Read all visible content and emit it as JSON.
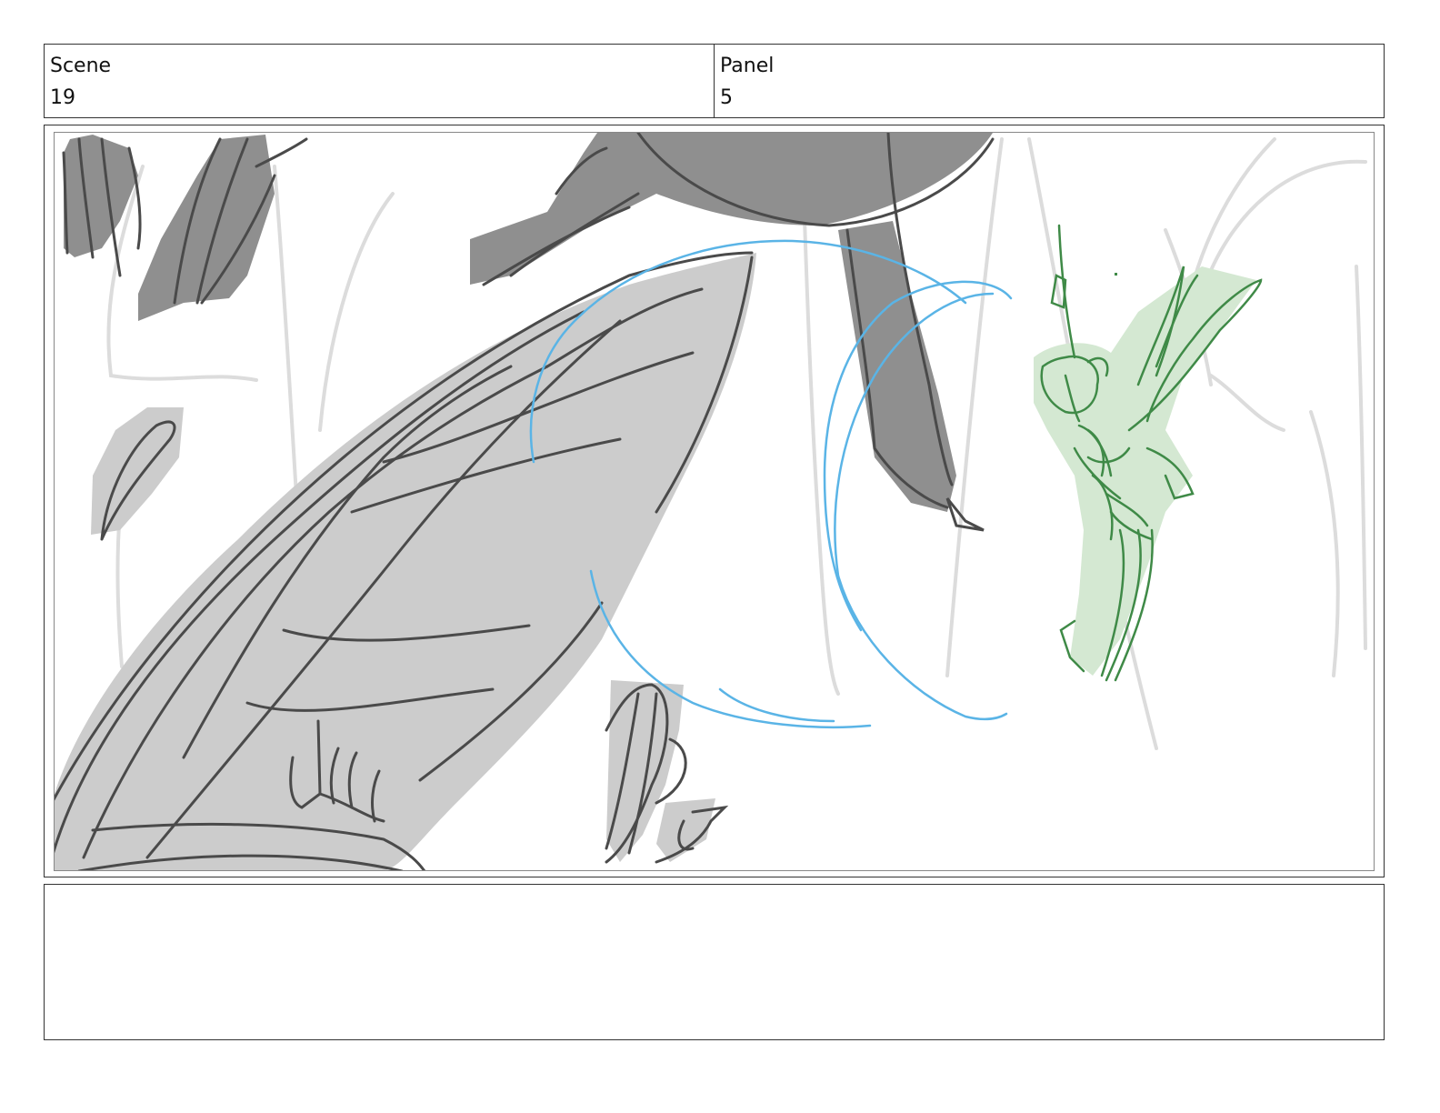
{
  "header": {
    "scene_label": "Scene",
    "scene_value": "19",
    "panel_label": "Panel",
    "panel_value": "5"
  },
  "notes": {
    "text": ""
  },
  "colors": {
    "border": "#333333",
    "shade_light": "#cccccc",
    "shade_dark": "#8f8f8f",
    "line_dark": "#4a4a4a",
    "line_faint": "#dcdcdc",
    "line_blue": "#5ab4e6",
    "line_green": "#3f8a47",
    "fill_green": "#d4e8d2"
  }
}
